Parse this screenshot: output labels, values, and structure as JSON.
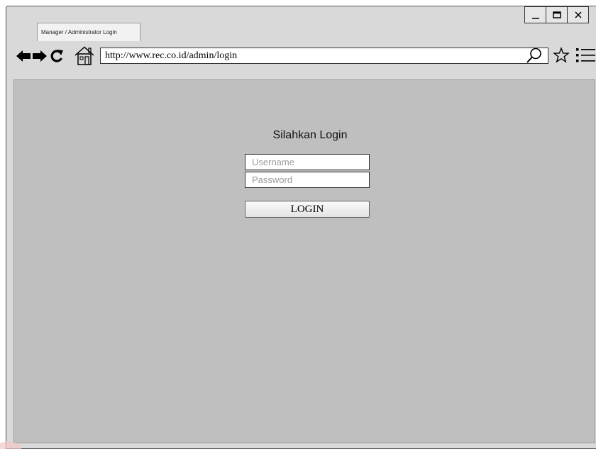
{
  "browser": {
    "tab_title": "Manager / Administrator Login",
    "url": "http://www.rec.co.id/admin/login",
    "window_controls": [
      "minimize-icon",
      "maximize-icon",
      "close-icon"
    ],
    "nav_icons": [
      "back-arrow-icon",
      "forward-arrow-icon",
      "reload-icon",
      "home-icon"
    ],
    "toolbar_icons": [
      "search-icon",
      "star-icon",
      "menu-icon"
    ]
  },
  "login": {
    "title": "Silahkan Login",
    "username_placeholder": "Username",
    "password_placeholder": "Password",
    "button_label": "LOGIN"
  },
  "colors": {
    "chrome": "#d9d9d9",
    "content_bg": "#bfbfbf",
    "tab_bg": "#f2f2f2"
  }
}
